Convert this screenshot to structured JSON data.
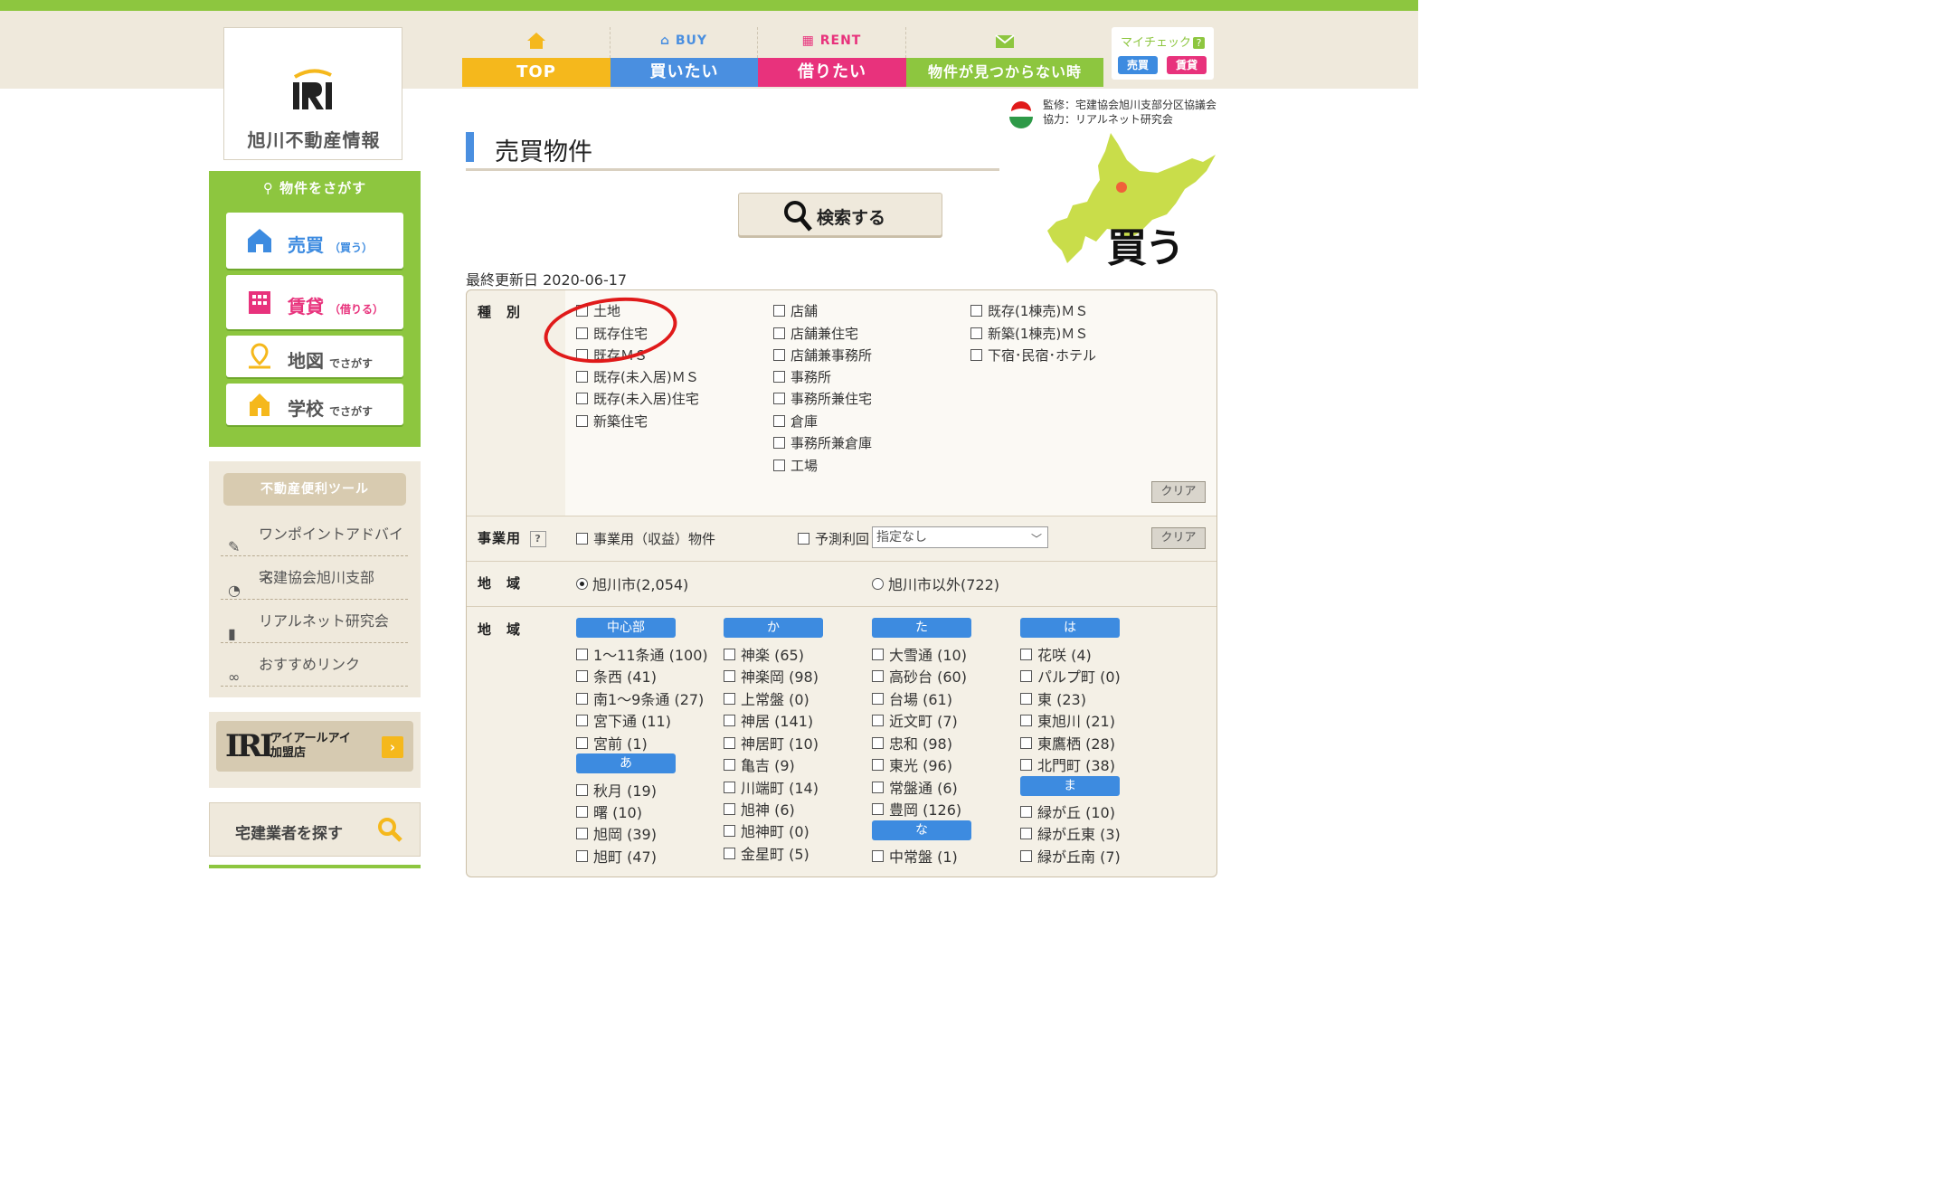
{
  "header": {
    "logo_text": "旭川不動産情報",
    "logo_mark_text": "IRI",
    "nav": [
      {
        "sub": "",
        "main": "TOP",
        "color": "#f5b81c",
        "icon": "home-icon"
      },
      {
        "sub": "BUY",
        "main": "買いたい",
        "color": "#4a8fe0",
        "icon": "house-icon"
      },
      {
        "sub": "RENT",
        "main": "借りたい",
        "color": "#e8327c",
        "icon": "building-icon"
      },
      {
        "sub": "",
        "main": "物件が見つからない時",
        "color": "#8dc63f",
        "icon": "mail-icon"
      }
    ],
    "mycheck": {
      "label": "マイチェック",
      "help": "?",
      "buy": "売買",
      "rent": "賃貸"
    }
  },
  "sidebar": {
    "search_title": "物件をさがす",
    "buttons": [
      {
        "label": "売買",
        "small": "（買う）",
        "color": "#3d8be0"
      },
      {
        "label": "賃貸",
        "small": "（借りる）",
        "color": "#e8327c"
      },
      {
        "label": "地図",
        "small": "でさがす",
        "color": "#555555"
      },
      {
        "label": "学校",
        "small": "でさがす",
        "color": "#555555"
      }
    ],
    "tools_title": "不動産便利ツール",
    "tools": [
      "ワンポイントアドバイス",
      "宅建協会旭川支部",
      "リアルネット研究会",
      "おすすめリンク"
    ],
    "iri_banner": {
      "logo": "IRI",
      "line1": "アイアールアイ",
      "line2": "加盟店",
      "arrow": "›"
    },
    "agent_search": "宅建業者を探す"
  },
  "main": {
    "title": "売買物件",
    "supervise_line1": "監修：宅建協会旭川支部分区協議会",
    "supervise_line2": "協力：リアルネット研究会",
    "map_label": "買う",
    "search_button": "検索する",
    "updated": "最終更新日 2020-06-17",
    "type_label": "種　別",
    "types_col1": [
      "土地",
      "既存住宅",
      "既存ＭＳ",
      "既存(未入居)ＭＳ",
      "既存(未入居)住宅",
      "新築住宅"
    ],
    "types_col2": [
      "店舗",
      "店舗兼住宅",
      "店舗兼事務所",
      "事務所",
      "事務所兼住宅",
      "倉庫",
      "事務所兼倉庫",
      "工場"
    ],
    "types_col3": [
      "既存(1棟売)ＭＳ",
      "新築(1棟売)ＭＳ",
      "下宿･民宿･ホテル"
    ],
    "clear": "クリア",
    "business_label": "事業用",
    "business_help": "?",
    "business_option": "事業用（収益）物件",
    "yield_label": "予測利回り",
    "yield_value": "指定なし",
    "region_label": "地　域",
    "region_asahikawa": "旭川市(2,054)",
    "region_other": "旭川市以外(722)",
    "area_label": "地　域",
    "area_columns": [
      {
        "groups": [
          {
            "head": "中心部",
            "items": [
              "1～11条通 (100)",
              "条西 (41)",
              "南1～9条通 (27)",
              "宮下通 (11)",
              "宮前 (1)"
            ]
          },
          {
            "head": "あ",
            "items": [
              "秋月 (19)",
              "曙 (10)",
              "旭岡 (39)",
              "旭町 (47)"
            ]
          }
        ]
      },
      {
        "groups": [
          {
            "head": "か",
            "items": [
              "神楽 (65)",
              "神楽岡 (98)",
              "上常盤 (0)",
              "神居 (141)",
              "神居町 (10)",
              "亀吉 (9)",
              "川端町 (14)",
              "旭神 (6)",
              "旭神町 (0)",
              "金星町 (5)"
            ]
          }
        ]
      },
      {
        "groups": [
          {
            "head": "た",
            "items": [
              "大雪通 (10)",
              "高砂台 (60)",
              "台場 (61)",
              "近文町 (7)",
              "忠和 (98)",
              "東光 (96)",
              "常盤通 (6)",
              "豊岡 (126)"
            ]
          },
          {
            "head": "な",
            "items": [
              "中常盤 (1)"
            ]
          }
        ]
      },
      {
        "groups": [
          {
            "head": "は",
            "items": [
              "花咲 (4)",
              "パルプ町 (0)",
              "東 (23)",
              "東旭川 (21)",
              "東鷹栖 (28)",
              "北門町 (38)"
            ]
          },
          {
            "head": "ま",
            "items": [
              "緑が丘 (10)",
              "緑が丘東 (3)",
              "緑が丘南 (7)"
            ]
          }
        ]
      }
    ]
  }
}
